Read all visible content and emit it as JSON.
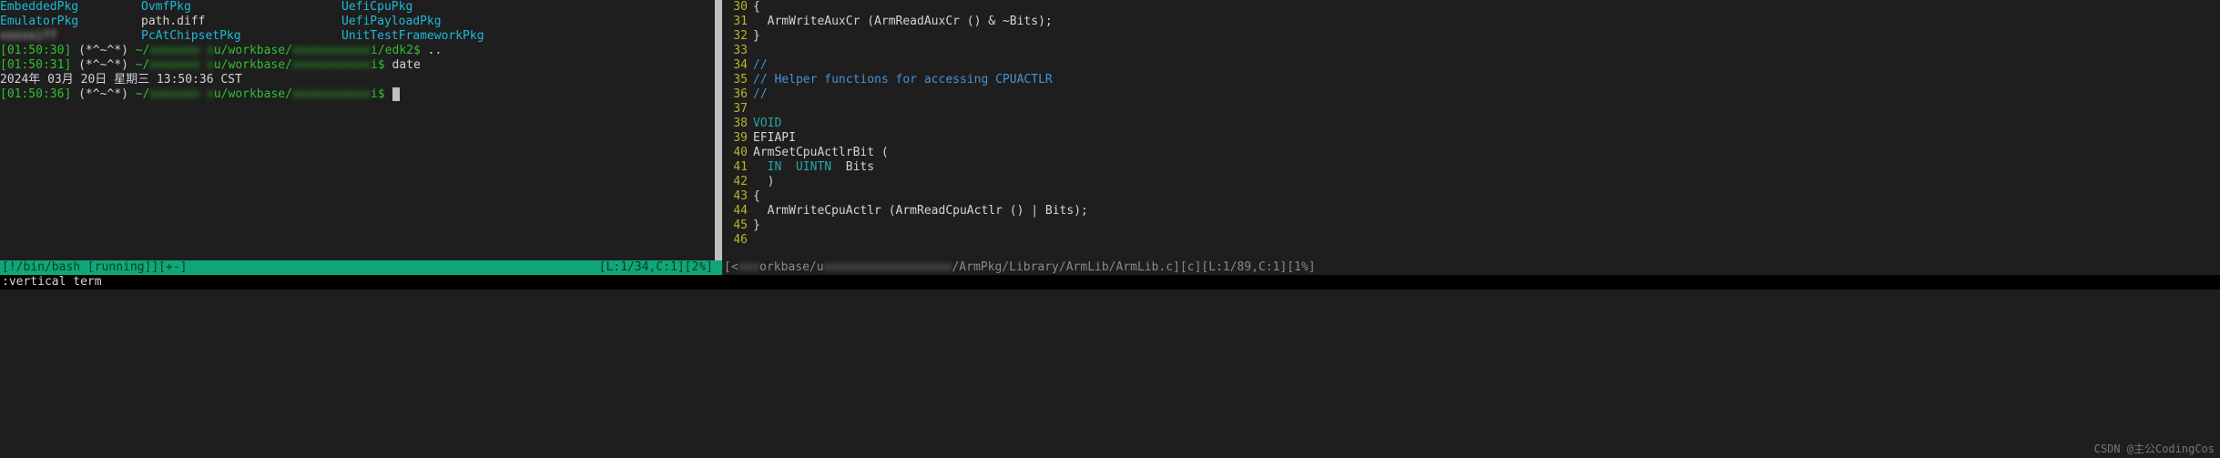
{
  "terminal": {
    "listing": {
      "c1r1": "EmbeddedPkg",
      "c2r1": "OvmfPkg",
      "c3r1": "UefiCpuPkg",
      "c1r2": "EmulatorPkg",
      "c2r2": "path.diff",
      "c3r2": "UefiPayloadPkg",
      "c1r3_obscured": "xxxxxiff",
      "c2r3": "PcAtChipsetPkg",
      "c3r3": "UnitTestFrameworkPkg"
    },
    "lines": [
      {
        "ts": "[01:50:30]",
        "sym": "(*^~^*)",
        "tilde": "~/",
        "blur1": "xxxxxxx x",
        "mid": "u/workbase/",
        "blur2": "xxxxxxxxxxx",
        "tail": "i/edk2$",
        "cmd": ".."
      },
      {
        "ts": "[01:50:31]",
        "sym": "(*^~^*)",
        "tilde": "~/",
        "blur1": "xxxxxxx x",
        "mid": "u/workbase/",
        "blur2": "xxxxxxxxxxx",
        "tail": "i$",
        "cmd": "date"
      }
    ],
    "date_output": "2024年 03月 20日 星期三 13:50:36 CST",
    "prompt3": {
      "ts": "[01:50:36]",
      "sym": "(*^~^*)",
      "tilde": "~/",
      "blur1": "xxxxxxx x",
      "mid": "u/workbase/",
      "blur2": "xxxxxxxxxxx",
      "tail": "i$"
    }
  },
  "code": {
    "lines": [
      {
        "n": "30",
        "text": "{"
      },
      {
        "n": "31",
        "text": "  ArmWriteAuxCr (ArmReadAuxCr () & ~Bits);"
      },
      {
        "n": "32",
        "text": "}"
      },
      {
        "n": "33",
        "text": ""
      },
      {
        "n": "34",
        "text": "//",
        "cm": true
      },
      {
        "n": "35",
        "text": "// Helper functions for accessing CPUACTLR",
        "cm": true
      },
      {
        "n": "36",
        "text": "//",
        "cm": true
      },
      {
        "n": "37",
        "text": ""
      },
      {
        "n": "38",
        "kw": "VOID"
      },
      {
        "n": "39",
        "text": "EFIAPI"
      },
      {
        "n": "40",
        "text": "ArmSetCpuActlrBit ("
      },
      {
        "n": "41",
        "kw": "  IN  UINTN",
        "rest": "  Bits"
      },
      {
        "n": "42",
        "text": "  )"
      },
      {
        "n": "43",
        "text": "{"
      },
      {
        "n": "44",
        "text": "  ArmWriteCpuActlr (ArmReadCpuActlr () | Bits);"
      },
      {
        "n": "45",
        "text": "}"
      },
      {
        "n": "46",
        "text": ""
      }
    ]
  },
  "statusbar": {
    "left": {
      "text": "[!/bin/bash [running]][+-]",
      "pos": "[L:1/34,C:1][2%]"
    },
    "right": {
      "pre": "[<",
      "blur1": "xxx",
      "mid1": "orkbase/u",
      "blur2": "xxxxxxxxxxxxxxxxxx",
      "mid2": "/ArmPkg/Library/ArmLib/ArmLib.c][c][L:1/89,C:1][1%]"
    }
  },
  "cmdline": ":vertical term",
  "watermark": "CSDN @主公CodingCos"
}
